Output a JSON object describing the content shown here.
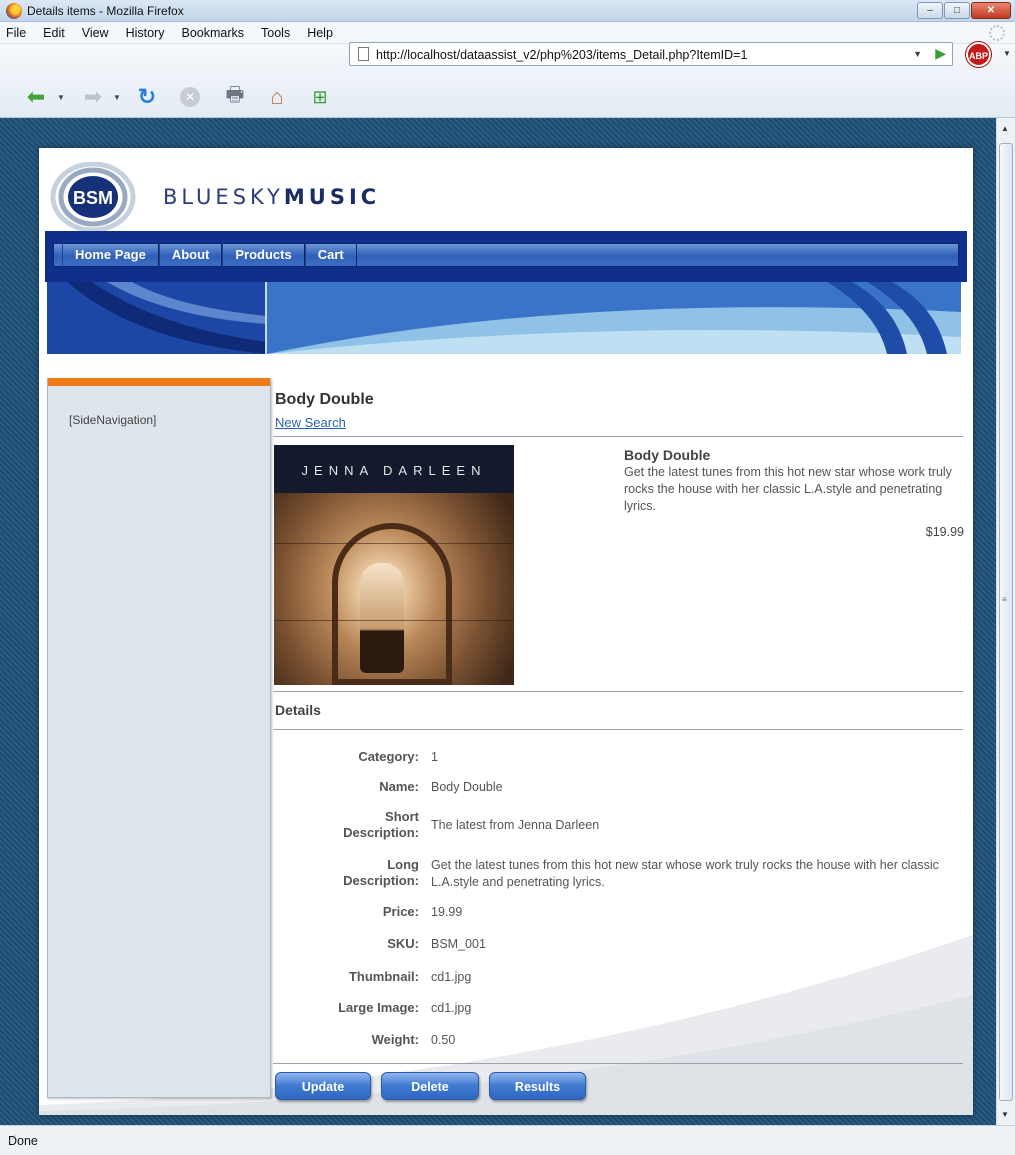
{
  "window": {
    "title": "Details items - Mozilla Firefox",
    "controls": [
      "–",
      "□",
      "✕"
    ]
  },
  "menu": [
    "File",
    "Edit",
    "View",
    "History",
    "Bookmarks",
    "Tools",
    "Help"
  ],
  "toolbar": {
    "url": "http://localhost/dataassist_v2/php%203/items_Detail.php?ItemID=1",
    "abp_label": "ABP"
  },
  "status": {
    "text": "Done"
  },
  "site": {
    "logo_badge": "BSM",
    "brand_light": "BLUESKY",
    "brand_bold": "MUSIC",
    "nav": [
      "Home Page",
      "About",
      "Products",
      "Cart"
    ],
    "side_navigation": "[SideNavigation]"
  },
  "item": {
    "title": "Body Double",
    "new_search": "New Search",
    "cover_artist": "JENNA DARLEEN",
    "summary_name": "Body Double",
    "summary_description": "Get the latest tunes from this hot new star whose work truly rocks the house with her classic L.A.style and penetrating lyrics.",
    "summary_price": "$19.99",
    "details_heading": "Details",
    "fields": [
      {
        "label": "Category:",
        "value": "1"
      },
      {
        "label": "Name:",
        "value": "Body Double"
      },
      {
        "label": "Short Description:",
        "value": "The latest from Jenna Darleen"
      },
      {
        "label": "Long Description:",
        "value": "Get the latest tunes from this hot new star whose work truly rocks the house with her classic L.A.style and penetrating lyrics."
      },
      {
        "label": "Price:",
        "value": "19.99"
      },
      {
        "label": "SKU:",
        "value": "BSM_001"
      },
      {
        "label": "Thumbnail:",
        "value": "cd1.jpg"
      },
      {
        "label": "Large Image:",
        "value": "cd1.jpg"
      },
      {
        "label": "Weight:",
        "value": "0.50"
      }
    ],
    "buttons": [
      "Update",
      "Delete",
      "Results"
    ]
  },
  "colors": {
    "nav_blue": "#0f2f8a",
    "sidebar_accent": "#ef7a1a",
    "button_blue": "#3f7ad1",
    "link_blue": "#2763b7"
  }
}
